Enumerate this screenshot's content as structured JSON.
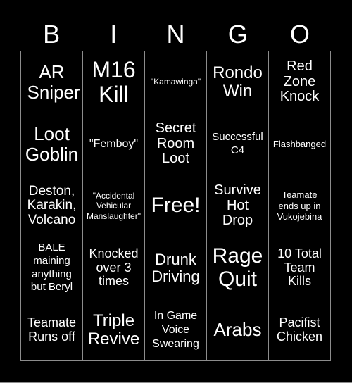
{
  "card": {
    "header_letters": [
      "B",
      "I",
      "N",
      "G",
      "O"
    ],
    "colors": {
      "background": "#000000",
      "text": "#ffffff",
      "grid_line": "#8c8c8c"
    },
    "cells": [
      {
        "text": "AR Sniper"
      },
      {
        "text": "M16 Kill"
      },
      {
        "text": "\"Kamawinga\""
      },
      {
        "text": "Rondo Win"
      },
      {
        "text": "Red Zone Knock"
      },
      {
        "text": "Loot Goblin"
      },
      {
        "text": "\"Femboy\""
      },
      {
        "text": "Secret Room Loot"
      },
      {
        "text": "Successful C4"
      },
      {
        "text": "Flashbanged"
      },
      {
        "text": "Deston, Karakin, Volcano"
      },
      {
        "text": "\"Accidental Vehicular Manslaughter\""
      },
      {
        "text": "Free!"
      },
      {
        "text": "Survive Hot Drop"
      },
      {
        "text": "Teamate ends up in Vukojebina"
      },
      {
        "text": "BALE maining anything but Beryl"
      },
      {
        "text": "Knocked over 3 times"
      },
      {
        "text": "Drunk Driving"
      },
      {
        "text": "Rage Quit"
      },
      {
        "text": "10 Total Team Kills"
      },
      {
        "text": "Teamate Runs off"
      },
      {
        "text": "Triple Revive"
      },
      {
        "text": "In Game Voice Swearing"
      },
      {
        "text": "Arabs"
      },
      {
        "text": "Pacifist Chicken"
      }
    ]
  }
}
